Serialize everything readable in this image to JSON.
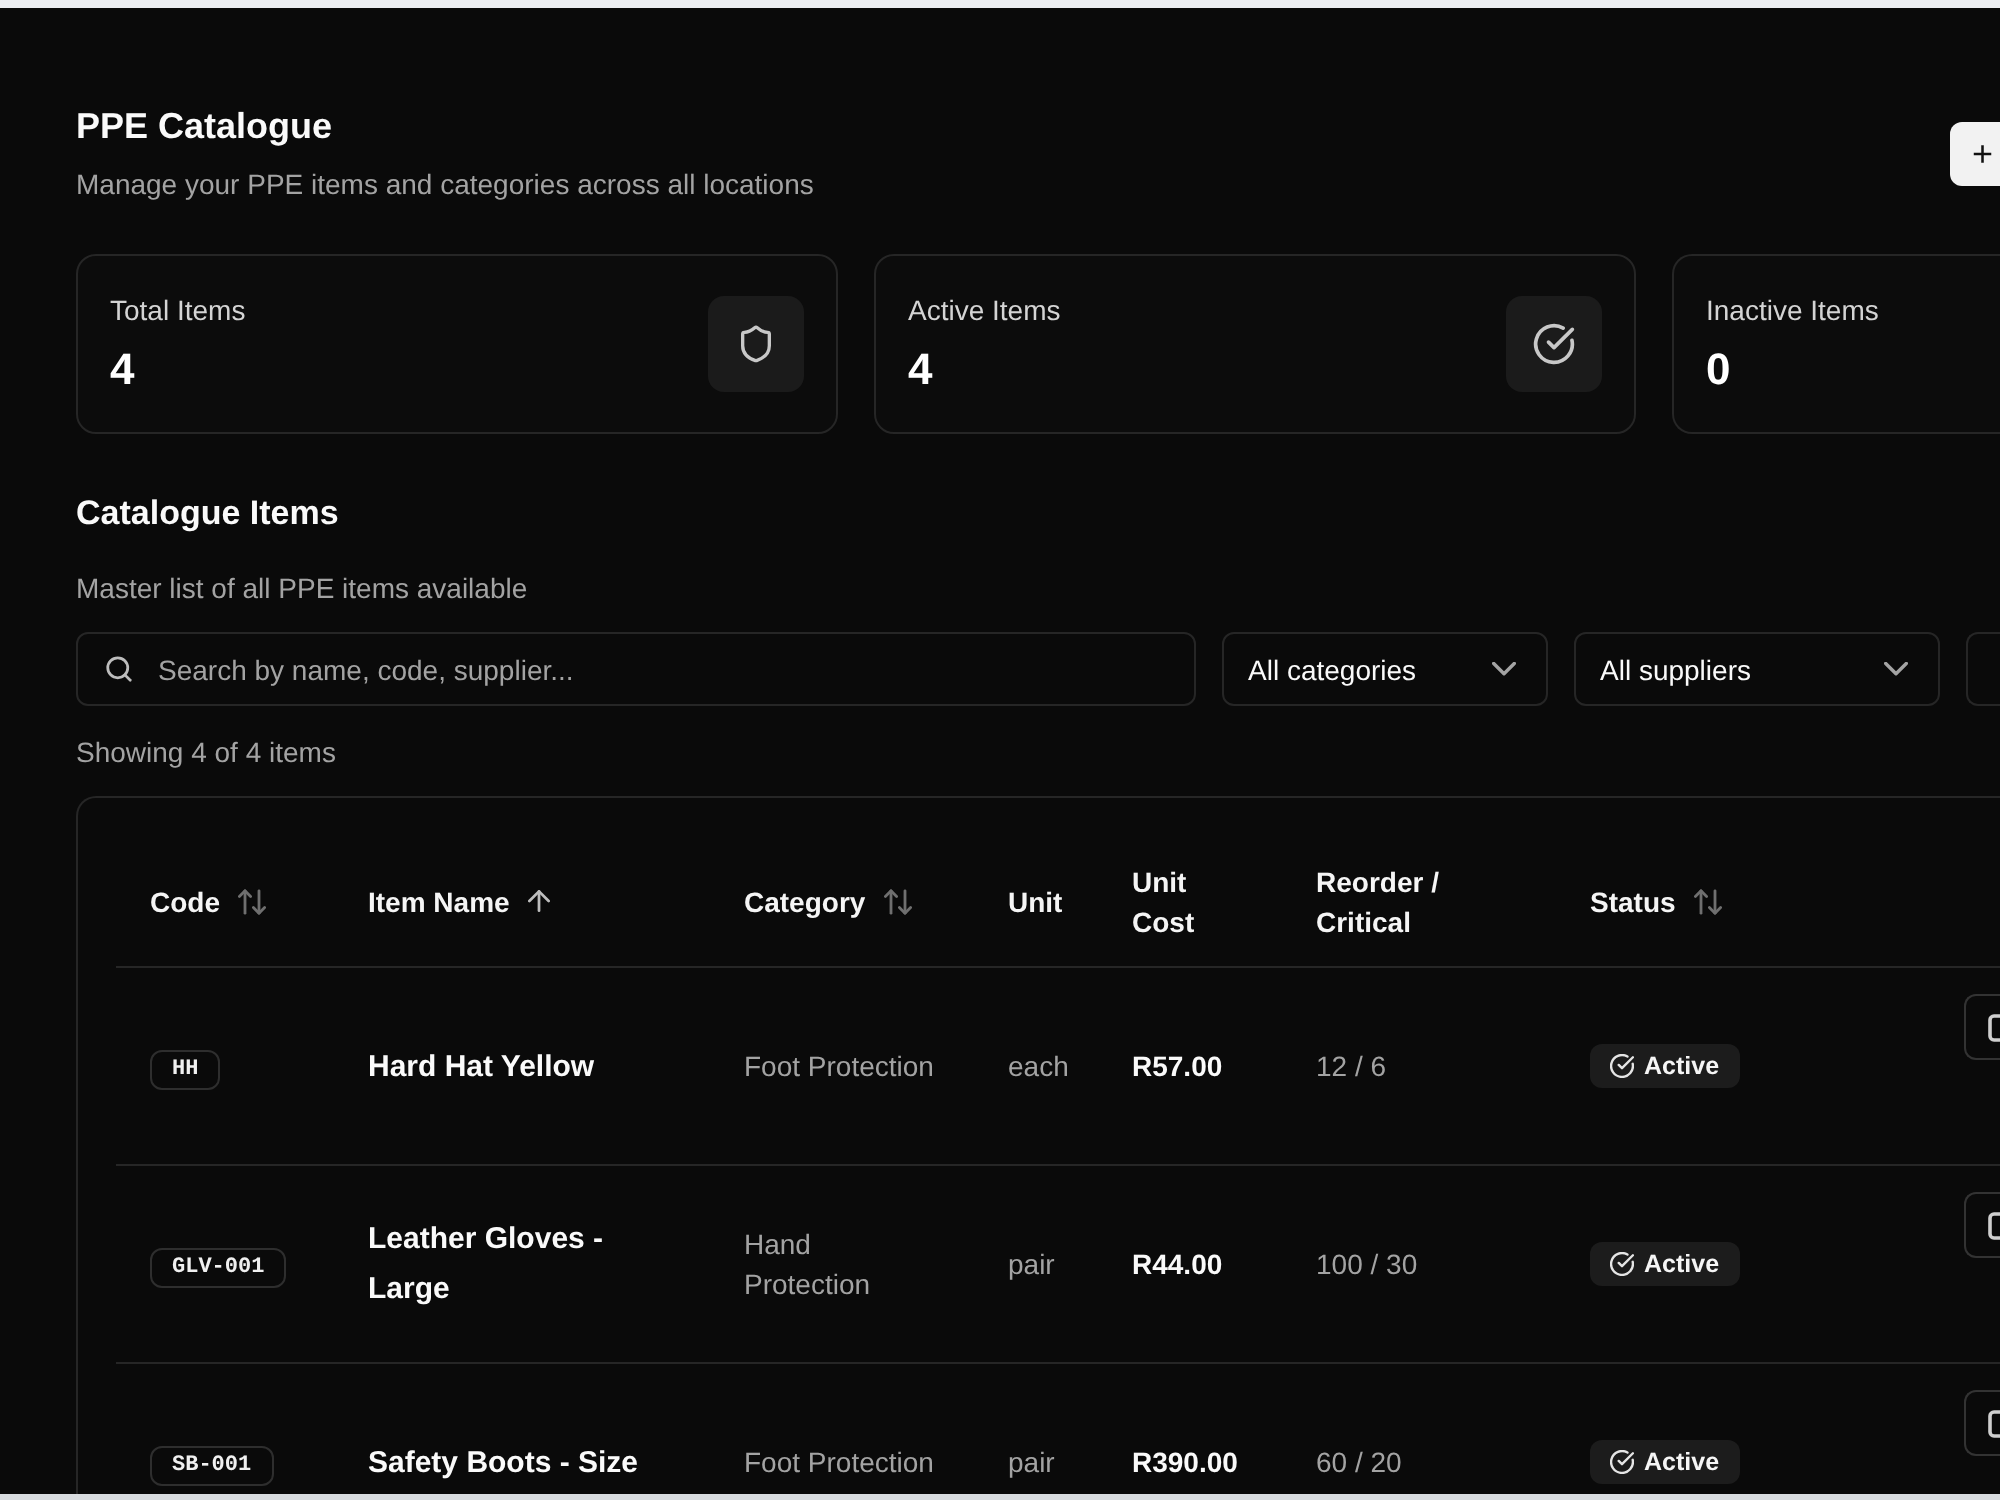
{
  "header": {
    "title": "PPE Catalogue",
    "subtitle": "Manage your PPE items and categories across all locations",
    "add_button": "+"
  },
  "stats": [
    {
      "label": "Total Items",
      "value": "4"
    },
    {
      "label": "Active Items",
      "value": "4"
    },
    {
      "label": "Inactive Items",
      "value": "0"
    }
  ],
  "catalogue": {
    "title": "Catalogue Items",
    "subtitle": "Master list of all PPE items available",
    "search": {
      "placeholder": "Search by name, code, supplier..."
    },
    "filters": [
      {
        "value": "All categories"
      },
      {
        "value": "All suppliers"
      }
    ],
    "result_count": "Showing 4 of 4 items"
  },
  "table": {
    "columns": [
      {
        "label": "Code",
        "sortable": true,
        "sorted": false
      },
      {
        "label": "Item Name",
        "sortable": true,
        "sorted": true
      },
      {
        "label": "Category",
        "sortable": true,
        "sorted": false
      },
      {
        "label": "Unit",
        "sortable": false,
        "sorted": false
      },
      {
        "label": "Unit Cost",
        "sortable": false,
        "sorted": false
      },
      {
        "label": "Reorder / Critical",
        "sortable": false,
        "sorted": false
      },
      {
        "label": "Status",
        "sortable": true,
        "sorted": false
      }
    ],
    "rows": [
      {
        "code": "HH",
        "name": "Hard Hat Yellow",
        "category": "Foot Protection",
        "unit": "each",
        "unit_cost": "R57.00",
        "reorder_critical": "12 / 6",
        "status": "Active"
      },
      {
        "code": "GLV-001",
        "name": "Leather Gloves - Large",
        "category": "Hand Protection",
        "unit": "pair",
        "unit_cost": "R44.00",
        "reorder_critical": "100 / 30",
        "status": "Active"
      },
      {
        "code": "SB-001",
        "name": "Safety Boots - Size",
        "category": "Foot Protection",
        "unit": "pair",
        "unit_cost": "R390.00",
        "reorder_critical": "60 / 20",
        "status": "Active"
      }
    ]
  }
}
